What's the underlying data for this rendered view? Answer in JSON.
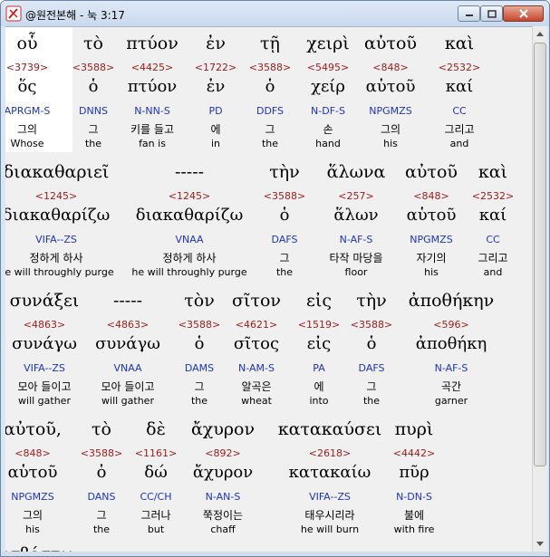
{
  "window": {
    "title": "@원전본해 - 눅 3:17"
  },
  "rows": [
    {
      "words": [
        {
          "greek": "οὗ",
          "strong": "<3739>",
          "lemma": "ὅς",
          "parse": "APRGM-S",
          "korean": "그의",
          "english": "Whose"
        },
        {
          "greek": "τὸ",
          "strong": "<3588>",
          "lemma": "ὁ",
          "parse": "DNNS",
          "korean": "그",
          "english": "the"
        },
        {
          "greek": "πτύον",
          "strong": "<4425>",
          "lemma": "πτύον",
          "parse": "N-NN-S",
          "korean": "키를 들고",
          "english": "fan is"
        },
        {
          "greek": "ἐν",
          "strong": "<1722>",
          "lemma": "ἐν",
          "parse": "PD",
          "korean": "에",
          "english": "in"
        },
        {
          "greek": "τῇ",
          "strong": "<3588>",
          "lemma": "ὁ",
          "parse": "DDFS",
          "korean": "그",
          "english": "the"
        },
        {
          "greek": "χειρὶ",
          "strong": "<5495>",
          "lemma": "χείρ",
          "parse": "N-DF-S",
          "korean": "손",
          "english": "hand"
        },
        {
          "greek": "αὐτοῦ",
          "strong": "<848>",
          "lemma": "αὑτοῦ",
          "parse": "NPGMZS",
          "korean": "그의",
          "english": "his"
        },
        {
          "greek": "καὶ",
          "strong": "<2532>",
          "lemma": "καί",
          "parse": "CC",
          "korean": "그리고",
          "english": "and"
        }
      ]
    },
    {
      "words": [
        {
          "greek": "διακαθαριεῖ",
          "strong": "<1245>",
          "lemma": "διακαθαρίζω",
          "parse": "VIFA--ZS",
          "korean": "정하게 하사",
          "english": "he will throughly purge"
        },
        {
          "greek": "-----",
          "strong": "<1245>",
          "lemma": "διακαθαρίζω",
          "parse": "VNAA",
          "korean": "정하게 하사",
          "english": "he will throughly purge"
        },
        {
          "greek": "τὴν",
          "strong": "<3588>",
          "lemma": "ὁ",
          "parse": "DAFS",
          "korean": "그",
          "english": "the"
        },
        {
          "greek": "ἅλωνα",
          "strong": "<257>",
          "lemma": "ἅλων",
          "parse": "N-AF-S",
          "korean": "타작 마당을",
          "english": "floor"
        },
        {
          "greek": "αὐτοῦ",
          "strong": "<848>",
          "lemma": "αὑτοῦ",
          "parse": "NPGMZS",
          "korean": "자기의",
          "english": "his"
        },
        {
          "greek": "καὶ",
          "strong": "<2532>",
          "lemma": "καί",
          "parse": "CC",
          "korean": "그리고",
          "english": "and"
        }
      ]
    },
    {
      "words": [
        {
          "greek": "συνάξει",
          "strong": "<4863>",
          "lemma": "συνάγω",
          "parse": "VIFA--ZS",
          "korean": "모아 들이고",
          "english": "will gather"
        },
        {
          "greek": "-----",
          "strong": "<4863>",
          "lemma": "συνάγω",
          "parse": "VNAA",
          "korean": "모아 들이고",
          "english": "will gather"
        },
        {
          "greek": "τὸν",
          "strong": "<3588>",
          "lemma": "ὁ",
          "parse": "DAMS",
          "korean": "그",
          "english": "the"
        },
        {
          "greek": "σῖτον",
          "strong": "<4621>",
          "lemma": "σῖτος",
          "parse": "N-AM-S",
          "korean": "알곡은",
          "english": "wheat"
        },
        {
          "greek": "εἰς",
          "strong": "<1519>",
          "lemma": "εἰς",
          "parse": "PA",
          "korean": "에",
          "english": "into"
        },
        {
          "greek": "τὴν",
          "strong": "<3588>",
          "lemma": "ὁ",
          "parse": "DAFS",
          "korean": "그",
          "english": "the"
        },
        {
          "greek": "ἀποθήκην",
          "strong": "<596>",
          "lemma": "ἀποθήκη",
          "parse": "N-AF-S",
          "korean": "곡간",
          "english": "garner"
        }
      ]
    },
    {
      "words": [
        {
          "greek": "αὐτοῦ,",
          "strong": "<848>",
          "lemma": "αὑτοῦ",
          "parse": "NPGMZS",
          "korean": "그의",
          "english": "his"
        },
        {
          "greek": "τὸ",
          "strong": "<3588>",
          "lemma": "ὁ",
          "parse": "DANS",
          "korean": "그",
          "english": "the"
        },
        {
          "greek": "δὲ",
          "strong": "<1161>",
          "lemma": "δώ",
          "parse": "CC/CH",
          "korean": "그러나",
          "english": "but"
        },
        {
          "greek": "ἄχυρον",
          "strong": "<892>",
          "lemma": "ἄχυρον",
          "parse": "N-AN-S",
          "korean": "쭉정이는",
          "english": "chaff"
        },
        {
          "greek": "κατακαύσει",
          "strong": "<2618>",
          "lemma": "κατακαίω",
          "parse": "VIFA--ZS",
          "korean": "태우시리라",
          "english": "he will burn"
        },
        {
          "greek": "πυρὶ",
          "strong": "<4442>",
          "lemma": "πῦρ",
          "parse": "N-DN-S",
          "korean": "불에",
          "english": "with fire"
        }
      ]
    }
  ],
  "partial_row_text": "ἀσβέστῳ."
}
